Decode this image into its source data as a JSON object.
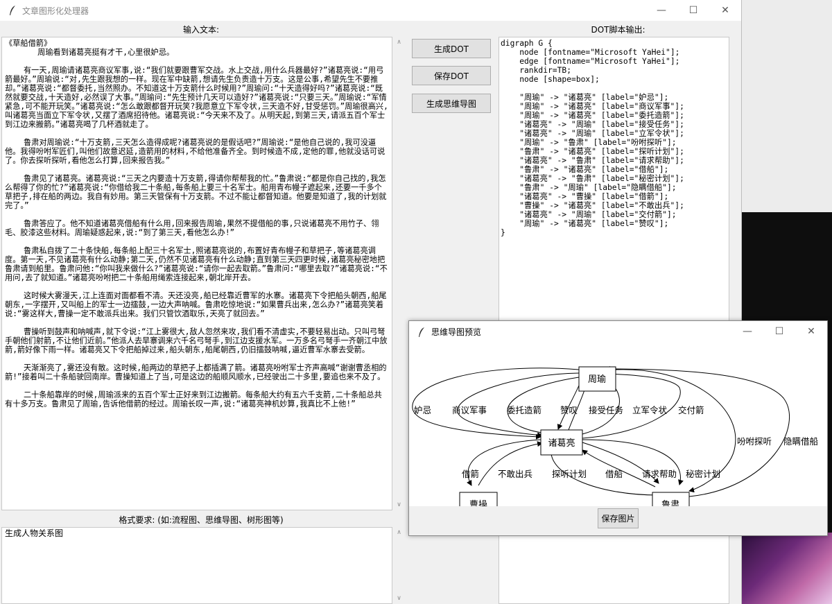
{
  "main_window": {
    "title": "文章图形化处理器",
    "input_label": "输入文本:",
    "output_label": "DOT脚本输出:",
    "format_label": "格式要求: (如:流程图、思维导图、树形图等)",
    "format_value": "生成人物关系图",
    "buttons": {
      "generate_dot": "生成DOT",
      "save_dot": "保存DOT",
      "generate_mindmap": "生成思维导图"
    },
    "input_text": "《草船借箭》\n       周瑜看到诸葛亮挺有才干,心里很妒忌。\n\n    有一天,周瑜请诸葛亮商议军事,说:“我们就要跟曹军交战。水上交战,用什么兵器最好?”诸葛亮说:“用弓箭最好。”周瑜说:“对,先生跟我想的一样。现在军中缺箭,想请先生负责造十万支。这是公事,希望先生不要推却。”诸葛亮说:“都督委托,当然照办。不知道这十万支箭什么时候用?”周瑜问:“十天造得好吗?”诸葛亮说:“既然就要交战,十天造好,必然误了大事。”周瑜问:“先生预计几天可以造好?”诸葛亮说:“只要三天。”周瑜说:“军情紧急,可不能开玩笑。”诸葛亮说:“怎么敢跟都督开玩笑?我愿意立下军令状,三天造不好,甘受惩罚。”周瑜很高兴,叫诸葛亮当面立下军令状,又摆了酒席招待他。诸葛亮说:“今天来不及了。从明天起,到第三天,请派五百个军士到江边来搬箭。”诸葛亮喝了几杯酒就走了。\n\n    鲁肃对周瑜说:“十万支箭,三天怎么造得成呢?诸葛亮说的是假话吧?”周瑜说:“是他自己说的,我可没逼他。我得吩咐军匠们,叫他们故意迟延,造箭用的材料,不给他准备齐全。到时候造不成,定他的罪,他就没话可说了。你去探听探听,看他怎么打算,回来报告我。”\n\n    鲁肃见了诸葛亮。诸葛亮说:“三天之内要造十万支箭,得请你帮帮我的忙。”鲁肃说:“都是你自己找的,我怎么帮得了你的忙?”诸葛亮说:“你借给我二十条船,每条船上要三十名军士。船用青布幔子遮起来,还要一千多个草把子,排在船的两边。我自有妙用。第三天管保有十万支箭。不过不能让都督知道。他要是知道了,我的计划就完了。”\n\n    鲁肃答应了。他不知道诸葛亮借船有什么用,回来报告周瑜,果然不提借船的事,只说诸葛亮不用竹子、翎毛、胶漆这些材料。周瑜疑惑起来,说:“到了第三天,看他怎么办!”\n\n    鲁肃私自拨了二十条快船,每条船上配三十名军士,照诸葛亮说的,布置好青布幔子和草把子,等诸葛亮调度。第一天,不见诸葛亮有什么动静;第二天,仍然不见诸葛亮有什么动静;直到第三天四更时候,诸葛亮秘密地把鲁肃请到船里。鲁肃问他:“你叫我来做什么?”诸葛亮说:“请你一起去取箭。”鲁肃问:“哪里去取?”诸葛亮说:“不用问,去了就知道。”诸葛亮吩咐把二十条船用绳索连接起来,朝北岸开去。\n\n    这时候大雾漫天,江上连面对面都看不清。天还没亮,船已经靠近曹军的水寨。诸葛亮下令把船头朝西,船尾朝东,一字摆开,又叫船上的军士一边擂鼓,一边大声呐喊。鲁肃吃惊地说:“如果曹兵出来,怎么办?”诸葛亮笑着说:“雾这样大,曹操一定不敢派兵出来。我们只管饮酒取乐,天亮了就回去。”\n\n    曹操听到鼓声和呐喊声,就下令说:“江上雾很大,敌人忽然来攻,我们看不清虚实,不要轻易出动。只叫弓弩手朝他们射箭,不让他们近前。”他派人去旱寨调来六千名弓弩手,到江边支援水军。一万多名弓弩手一齐朝江中放箭,箭好像下雨一样。诸葛亮又下令把船掉过来,船头朝东,船尾朝西,仍旧擂鼓呐喊,逼近曹军水寨去受箭。\n\n    天渐渐亮了,雾还没有散。这时候,船两边的草把子上都插满了箭。诸葛亮吩咐军士齐声高喊“谢谢曹丞相的箭!”接着叫二十条船驶回南岸。曹操知道上了当,可是这边的船顺风顺水,已经驶出二十多里,要追也来不及了。\n\n    二十条船靠岸的时候,周瑜派来的五百个军士正好来到江边搬箭。每条船大约有五六千支箭,二十条船总共有十多万支。鲁肃见了周瑜,告诉他借箭的经过。周瑜长叹一声,说:“诸葛亮神机妙算,我真比不上他!”",
    "dot_output": "digraph G {\n    node [fontname=\"Microsoft YaHei\"];\n    edge [fontname=\"Microsoft YaHei\"];\n    rankdir=TB;\n    node [shape=box];\n\n    \"周瑜\" -> \"诸葛亮\" [label=\"妒忌\"];\n    \"周瑜\" -> \"诸葛亮\" [label=\"商议军事\"];\n    \"周瑜\" -> \"诸葛亮\" [label=\"委托造箭\"];\n    \"诸葛亮\" -> \"周瑜\" [label=\"接受任务\"];\n    \"诸葛亮\" -> \"周瑜\" [label=\"立军令状\"];\n    \"周瑜\" -> \"鲁肃\" [label=\"吩咐探听\"];\n    \"鲁肃\" -> \"诸葛亮\" [label=\"探听计划\"];\n    \"诸葛亮\" -> \"鲁肃\" [label=\"请求帮助\"];\n    \"鲁肃\" -> \"诸葛亮\" [label=\"借船\"];\n    \"诸葛亮\" -> \"鲁肃\" [label=\"秘密计划\"];\n    \"鲁肃\" -> \"周瑜\" [label=\"隐瞒借船\"];\n    \"诸葛亮\" -> \"曹操\" [label=\"借箭\"];\n    \"曹操\" -> \"诸葛亮\" [label=\"不敢出兵\"];\n    \"诸葛亮\" -> \"周瑜\" [label=\"交付箭\"];\n    \"周瑜\" -> \"诸葛亮\" [label=\"赞叹\"];\n}"
  },
  "preview_window": {
    "title": "思维导图预览",
    "save_button": "保存图片",
    "nodes": {
      "zhouyu": "周瑜",
      "zhugeliang": "诸葛亮",
      "caocao": "曹操",
      "lusu": "鲁肃"
    },
    "edge_labels": {
      "jidu": "妒忌",
      "shangyi": "商议军事",
      "weituo": "委托造箭",
      "zantan": "赞叹",
      "jieshou": "接受任务",
      "lijunling": "立军令状",
      "jiaofu": "交付箭",
      "fenfu": "吩咐探听",
      "yinman": "隐瞒借船",
      "jiejian": "借箭",
      "bugan": "不敢出兵",
      "tanting": "探听计划",
      "jiechuan": "借船",
      "qingqiu": "请求帮助",
      "mimi": "秘密计划"
    }
  },
  "icons": {
    "app": "feather-icon",
    "minimize": "minimize-icon",
    "maximize": "maximize-icon",
    "close": "close-icon"
  },
  "colors": {
    "window_bg": "#f0f0f0",
    "button_bg": "#e1e1e1",
    "button_border": "#adadad"
  }
}
